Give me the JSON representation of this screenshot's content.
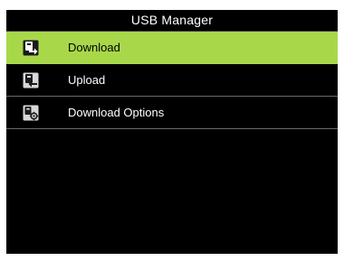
{
  "title": "USB Manager",
  "colors": {
    "background": "#000000",
    "selected_row": "#a8d84a",
    "text": "#ffffff",
    "selected_text": "#000000"
  },
  "menu": {
    "items": [
      {
        "label": "Download",
        "icon": "download-icon",
        "selected": true
      },
      {
        "label": "Upload",
        "icon": "upload-icon",
        "selected": false
      },
      {
        "label": "Download Options",
        "icon": "download-options-icon",
        "selected": false
      }
    ]
  }
}
